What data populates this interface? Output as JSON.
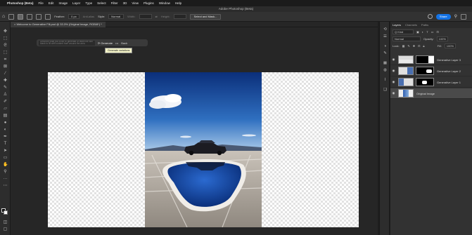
{
  "menubar": {
    "app_name": "Photoshop (Beta)",
    "items": [
      "File",
      "Edit",
      "Image",
      "Layer",
      "Type",
      "Select",
      "Filter",
      "3D",
      "View",
      "Plugins",
      "Window",
      "Help"
    ]
  },
  "window": {
    "title": "Adobe Photoshop (Beta)"
  },
  "options_bar": {
    "feather_label": "Feather:",
    "feather_value": "0 px",
    "anti_alias_label": "Anti-alias",
    "style_label": "Style:",
    "style_value": "Normal",
    "width_label": "Width:",
    "height_label": "Height:",
    "select_mask_label": "Select and Mask...",
    "share_label": "Share"
  },
  "document_tab": {
    "label": "Welcome to Generative Fill.psd @ 33.3% (Original Image, RGB/8*) *"
  },
  "task_bar": {
    "prompt_placeholder": "Describe what you'd like to generate or leave the box blank to fill with content from around the area",
    "generate_label": "Generate",
    "more_label": "•••",
    "back_label": "Back",
    "tooltip": "Generate variations"
  },
  "layers_panel": {
    "tabs": [
      "Layers",
      "Channels",
      "Paths"
    ],
    "kind_filter": "Q Kind",
    "blend_mode": "Normal",
    "opacity_label": "Opacity:",
    "opacity_value": "100%",
    "lock_label": "Lock:",
    "fill_label": "Fill:",
    "fill_value": "100%",
    "layers": [
      {
        "name": "Generative Layer 3",
        "selected": false
      },
      {
        "name": "Generative Layer 2",
        "selected": false
      },
      {
        "name": "Generative Layer 1",
        "selected": false
      },
      {
        "name": "Original Image",
        "selected": true
      }
    ]
  },
  "icons": {
    "toolbar": [
      "move-icon",
      "marquee-icon",
      "lasso-icon",
      "object-select-icon",
      "crop-icon",
      "frame-icon",
      "eyedropper-icon",
      "healing-brush-icon",
      "brush-icon",
      "clone-stamp-icon",
      "history-brush-icon",
      "eraser-icon",
      "gradient-icon",
      "blur-icon",
      "dodge-icon",
      "pen-icon",
      "type-icon",
      "path-select-icon",
      "rectangle-icon",
      "hand-icon",
      "zoom-icon",
      "more-tools-icon"
    ],
    "side_panel": [
      "history-icon",
      "properties-icon",
      "adjustments-icon",
      "brushes-icon",
      "libraries-icon",
      "color-icon",
      "paths-icon",
      "layers-icon"
    ]
  },
  "colors": {
    "accent": "#1473e6",
    "panel": "#323232",
    "canvas": "#262626"
  }
}
